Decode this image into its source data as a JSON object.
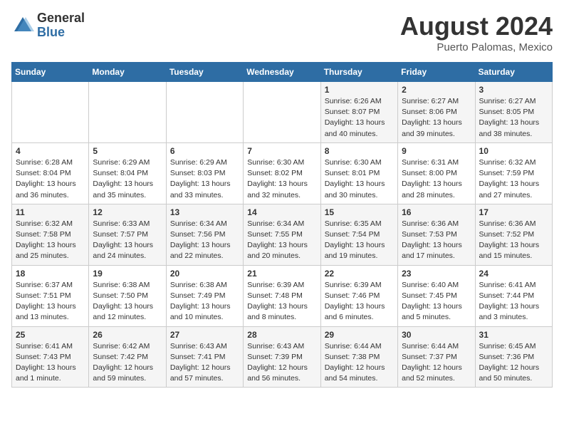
{
  "logo": {
    "general": "General",
    "blue": "Blue"
  },
  "title": {
    "month_year": "August 2024",
    "location": "Puerto Palomas, Mexico"
  },
  "calendar": {
    "headers": [
      "Sunday",
      "Monday",
      "Tuesday",
      "Wednesday",
      "Thursday",
      "Friday",
      "Saturday"
    ],
    "weeks": [
      [
        {
          "day": "",
          "info": ""
        },
        {
          "day": "",
          "info": ""
        },
        {
          "day": "",
          "info": ""
        },
        {
          "day": "",
          "info": ""
        },
        {
          "day": "1",
          "info": "Sunrise: 6:26 AM\nSunset: 8:07 PM\nDaylight: 13 hours\nand 40 minutes."
        },
        {
          "day": "2",
          "info": "Sunrise: 6:27 AM\nSunset: 8:06 PM\nDaylight: 13 hours\nand 39 minutes."
        },
        {
          "day": "3",
          "info": "Sunrise: 6:27 AM\nSunset: 8:05 PM\nDaylight: 13 hours\nand 38 minutes."
        }
      ],
      [
        {
          "day": "4",
          "info": "Sunrise: 6:28 AM\nSunset: 8:04 PM\nDaylight: 13 hours\nand 36 minutes."
        },
        {
          "day": "5",
          "info": "Sunrise: 6:29 AM\nSunset: 8:04 PM\nDaylight: 13 hours\nand 35 minutes."
        },
        {
          "day": "6",
          "info": "Sunrise: 6:29 AM\nSunset: 8:03 PM\nDaylight: 13 hours\nand 33 minutes."
        },
        {
          "day": "7",
          "info": "Sunrise: 6:30 AM\nSunset: 8:02 PM\nDaylight: 13 hours\nand 32 minutes."
        },
        {
          "day": "8",
          "info": "Sunrise: 6:30 AM\nSunset: 8:01 PM\nDaylight: 13 hours\nand 30 minutes."
        },
        {
          "day": "9",
          "info": "Sunrise: 6:31 AM\nSunset: 8:00 PM\nDaylight: 13 hours\nand 28 minutes."
        },
        {
          "day": "10",
          "info": "Sunrise: 6:32 AM\nSunset: 7:59 PM\nDaylight: 13 hours\nand 27 minutes."
        }
      ],
      [
        {
          "day": "11",
          "info": "Sunrise: 6:32 AM\nSunset: 7:58 PM\nDaylight: 13 hours\nand 25 minutes."
        },
        {
          "day": "12",
          "info": "Sunrise: 6:33 AM\nSunset: 7:57 PM\nDaylight: 13 hours\nand 24 minutes."
        },
        {
          "day": "13",
          "info": "Sunrise: 6:34 AM\nSunset: 7:56 PM\nDaylight: 13 hours\nand 22 minutes."
        },
        {
          "day": "14",
          "info": "Sunrise: 6:34 AM\nSunset: 7:55 PM\nDaylight: 13 hours\nand 20 minutes."
        },
        {
          "day": "15",
          "info": "Sunrise: 6:35 AM\nSunset: 7:54 PM\nDaylight: 13 hours\nand 19 minutes."
        },
        {
          "day": "16",
          "info": "Sunrise: 6:36 AM\nSunset: 7:53 PM\nDaylight: 13 hours\nand 17 minutes."
        },
        {
          "day": "17",
          "info": "Sunrise: 6:36 AM\nSunset: 7:52 PM\nDaylight: 13 hours\nand 15 minutes."
        }
      ],
      [
        {
          "day": "18",
          "info": "Sunrise: 6:37 AM\nSunset: 7:51 PM\nDaylight: 13 hours\nand 13 minutes."
        },
        {
          "day": "19",
          "info": "Sunrise: 6:38 AM\nSunset: 7:50 PM\nDaylight: 13 hours\nand 12 minutes."
        },
        {
          "day": "20",
          "info": "Sunrise: 6:38 AM\nSunset: 7:49 PM\nDaylight: 13 hours\nand 10 minutes."
        },
        {
          "day": "21",
          "info": "Sunrise: 6:39 AM\nSunset: 7:48 PM\nDaylight: 13 hours\nand 8 minutes."
        },
        {
          "day": "22",
          "info": "Sunrise: 6:39 AM\nSunset: 7:46 PM\nDaylight: 13 hours\nand 6 minutes."
        },
        {
          "day": "23",
          "info": "Sunrise: 6:40 AM\nSunset: 7:45 PM\nDaylight: 13 hours\nand 5 minutes."
        },
        {
          "day": "24",
          "info": "Sunrise: 6:41 AM\nSunset: 7:44 PM\nDaylight: 13 hours\nand 3 minutes."
        }
      ],
      [
        {
          "day": "25",
          "info": "Sunrise: 6:41 AM\nSunset: 7:43 PM\nDaylight: 13 hours\nand 1 minute."
        },
        {
          "day": "26",
          "info": "Sunrise: 6:42 AM\nSunset: 7:42 PM\nDaylight: 12 hours\nand 59 minutes."
        },
        {
          "day": "27",
          "info": "Sunrise: 6:43 AM\nSunset: 7:41 PM\nDaylight: 12 hours\nand 57 minutes."
        },
        {
          "day": "28",
          "info": "Sunrise: 6:43 AM\nSunset: 7:39 PM\nDaylight: 12 hours\nand 56 minutes."
        },
        {
          "day": "29",
          "info": "Sunrise: 6:44 AM\nSunset: 7:38 PM\nDaylight: 12 hours\nand 54 minutes."
        },
        {
          "day": "30",
          "info": "Sunrise: 6:44 AM\nSunset: 7:37 PM\nDaylight: 12 hours\nand 52 minutes."
        },
        {
          "day": "31",
          "info": "Sunrise: 6:45 AM\nSunset: 7:36 PM\nDaylight: 12 hours\nand 50 minutes."
        }
      ]
    ]
  }
}
